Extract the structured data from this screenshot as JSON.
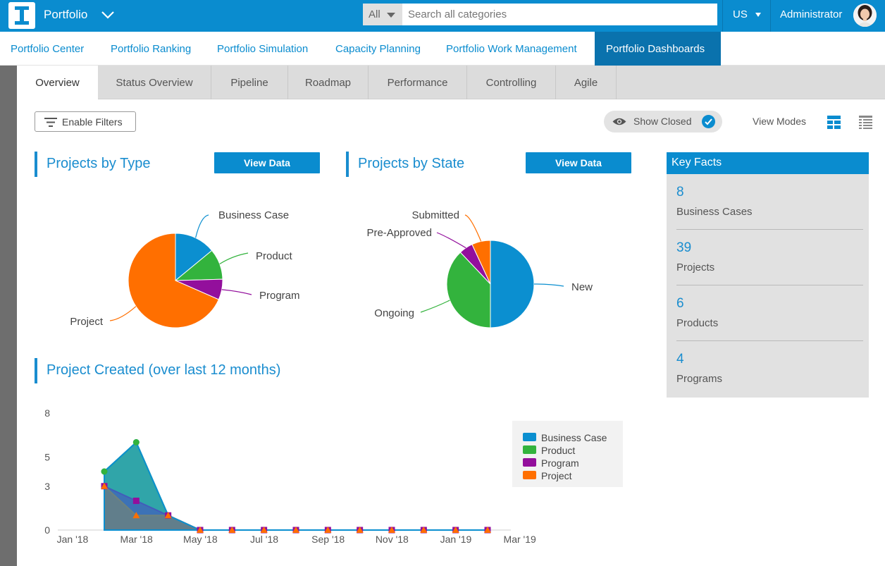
{
  "header": {
    "app_name": "Portfolio",
    "search_scope": "All",
    "search_placeholder": "Search all categories",
    "language": "US",
    "user": "Administrator"
  },
  "nav": {
    "items": [
      {
        "label": "Portfolio Center"
      },
      {
        "label": "Portfolio Ranking"
      },
      {
        "label": "Portfolio Simulation"
      },
      {
        "label": "Capacity Planning"
      },
      {
        "label": "Portfolio Work Management"
      },
      {
        "label": "Portfolio Dashboards"
      }
    ],
    "active": "Portfolio Dashboards"
  },
  "subtabs": {
    "items": [
      {
        "label": "Overview"
      },
      {
        "label": "Status Overview"
      },
      {
        "label": "Pipeline"
      },
      {
        "label": "Roadmap"
      },
      {
        "label": "Performance"
      },
      {
        "label": "Controlling"
      },
      {
        "label": "Agile"
      }
    ],
    "active": "Overview"
  },
  "toolbar": {
    "filters_label": "Enable Filters",
    "show_closed_label": "Show Closed",
    "show_closed_checked": true,
    "view_modes_label": "View Modes"
  },
  "sections": {
    "type_title": "Projects by Type",
    "state_title": "Projects by State",
    "created_title": "Project Created (over last 12 months)",
    "view_data_label": "View Data"
  },
  "colors": {
    "accent": "#0a8ccf",
    "business_case": "#0b8fd0",
    "product": "#33b33d",
    "program": "#930f9c",
    "project": "#ff6f00"
  },
  "key_facts": {
    "title": "Key Facts",
    "items": [
      {
        "value": "8",
        "label": "Business Cases"
      },
      {
        "value": "39",
        "label": "Projects"
      },
      {
        "value": "6",
        "label": "Products"
      },
      {
        "value": "4",
        "label": "Programs"
      }
    ]
  },
  "chart_data": [
    {
      "type": "pie",
      "title": "Projects by Type",
      "categories": [
        "Business Case",
        "Product",
        "Program",
        "Project"
      ],
      "values": [
        8,
        6,
        4,
        39
      ],
      "colors": [
        "#0b8fd0",
        "#33b33d",
        "#930f9c",
        "#ff6f00"
      ]
    },
    {
      "type": "pie",
      "title": "Projects by State",
      "categories": [
        "New",
        "Ongoing",
        "Pre-Approved",
        "Submitted"
      ],
      "values": [
        29,
        22,
        3,
        4
      ],
      "colors": [
        "#0b8fd0",
        "#33b33d",
        "#930f9c",
        "#ff6f00"
      ]
    },
    {
      "type": "area",
      "title": "Project Created (over last 12 months)",
      "x_ticks": [
        "Jan '18",
        "Mar '18",
        "May '18",
        "Jul '18",
        "Sep '18",
        "Nov '18",
        "Jan '19",
        "Mar '19"
      ],
      "y_ticks": [
        "0",
        "3",
        "5",
        "8"
      ],
      "ylim": [
        0,
        8
      ],
      "x_points": [
        "Feb '18",
        "Mar '18",
        "Apr '18",
        "May '18",
        "Jun '18",
        "Jul '18",
        "Aug '18",
        "Sep '18",
        "Oct '18",
        "Nov '18",
        "Dec '18",
        "Jan '19",
        "Feb '19"
      ],
      "series": [
        {
          "name": "Business Case",
          "values": [
            4,
            6,
            1,
            0,
            0,
            0,
            0,
            0,
            0,
            0,
            0,
            0,
            0
          ],
          "color": "#0b8fd0"
        },
        {
          "name": "Product",
          "values": [
            4,
            6,
            1,
            0,
            0,
            0,
            0,
            0,
            0,
            0,
            0,
            0,
            0
          ],
          "color": "#33b33d"
        },
        {
          "name": "Program",
          "values": [
            3,
            2,
            1,
            0,
            0,
            0,
            0,
            0,
            0,
            0,
            0,
            0,
            0
          ],
          "color": "#930f9c"
        },
        {
          "name": "Project",
          "values": [
            3,
            1,
            1,
            0,
            0,
            0,
            0,
            0,
            0,
            0,
            0,
            0,
            0
          ],
          "color": "#ff6f00"
        }
      ],
      "legend": "right"
    }
  ]
}
